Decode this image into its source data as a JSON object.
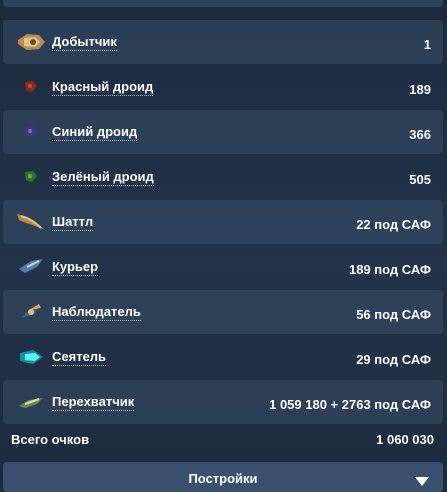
{
  "rows": [
    {
      "name": "Добытчик",
      "value": "1",
      "icon": "miner-ship-icon",
      "color": "#c9a46a"
    },
    {
      "name": "Красный дроид",
      "value": "189",
      "icon": "red-droid-icon",
      "color": "#9b2a22"
    },
    {
      "name": "Синий дроид",
      "value": "366",
      "icon": "blue-droid-icon",
      "color": "#4a3a8a"
    },
    {
      "name": "Зелёный дроид",
      "value": "505",
      "icon": "green-droid-icon",
      "color": "#3f7a2c"
    },
    {
      "name": "Шаттл",
      "value": "22 под САФ",
      "icon": "shuttle-icon",
      "color": "#b88c4a"
    },
    {
      "name": "Курьер",
      "value": "189 под САФ",
      "icon": "courier-icon",
      "color": "#5a8ab8"
    },
    {
      "name": "Наблюдатель",
      "value": "56 под САФ",
      "icon": "observer-icon",
      "color": "#c89a52"
    },
    {
      "name": "Сеятель",
      "value": "29 под САФ",
      "icon": "seeder-icon",
      "color": "#37d8e0"
    },
    {
      "name": "Перехватчик",
      "value": "1 059 180 + 2763 под САФ",
      "icon": "interceptor-icon",
      "color": "#8aa860"
    }
  ],
  "total": {
    "label": "Всего очков",
    "value": "1 060 030"
  },
  "settings": {
    "label": "Постройки",
    "icon": "chevron-down-icon"
  }
}
